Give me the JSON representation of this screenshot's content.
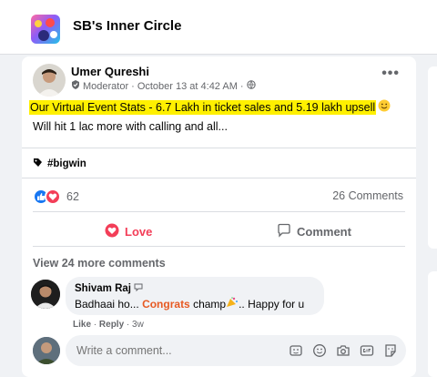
{
  "group": {
    "name": "SB's Inner Circle"
  },
  "post": {
    "author": "Umer Qureshi",
    "role": "Moderator",
    "date": "October 13 at 4:42 AM",
    "highlight_text": "Our Virtual Event Stats - 6.7 Lakh in ticket sales and 5.19 lakh upsell",
    "body_line2": "Will hit 1 lac more with calling and all...",
    "hashtag": "#bigwin",
    "reaction_count": "62",
    "comment_count": "26 Comments",
    "more_label": "•••"
  },
  "actions": {
    "love": "Love",
    "comment": "Comment"
  },
  "comments": {
    "view_more": "View 24 more comments",
    "items": [
      {
        "name": "Shivam Raj",
        "text_before": "Badhaai ho... ",
        "highlight": "Congrats",
        "text_after": " champ",
        "text_end": ".. Happy for u",
        "like": "Like",
        "reply": "Reply",
        "time": "3w"
      }
    ]
  },
  "composer": {
    "placeholder": "Write a comment..."
  },
  "colors": {
    "accent_blue": "#1877f2",
    "love_red": "#f33e58",
    "highlight": "#fff000"
  }
}
